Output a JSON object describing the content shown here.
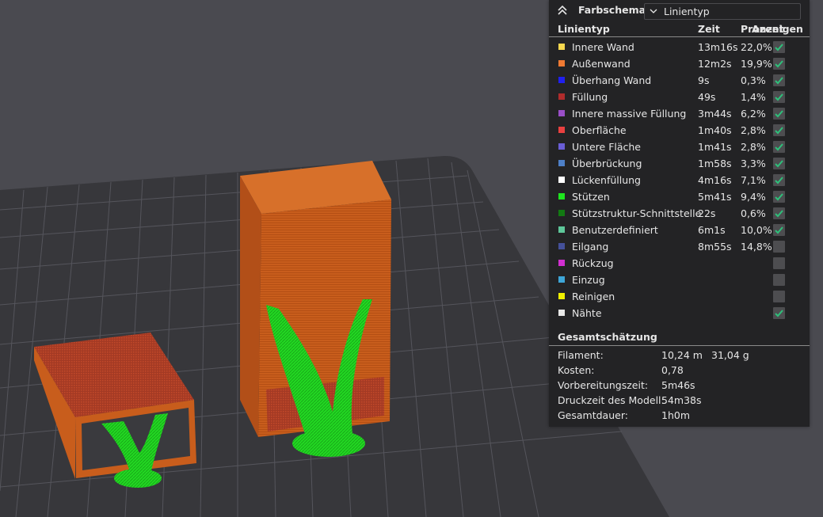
{
  "legend": {
    "title": "Farbschema",
    "scheme_value": "Linientyp",
    "columns": {
      "type": "Linientyp",
      "time": "Zeit",
      "percent": "Prozent",
      "show": "Anzeigen"
    },
    "rows": [
      {
        "label": "Innere Wand",
        "time": "13m16s",
        "percent": "22,0%",
        "color": "#f6d84f",
        "checked": true
      },
      {
        "label": "Außenwand",
        "time": "12m2s",
        "percent": "19,9%",
        "color": "#f07a33",
        "checked": true
      },
      {
        "label": "Überhang Wand",
        "time": "9s",
        "percent": "0,3%",
        "color": "#2020f0",
        "checked": true
      },
      {
        "label": "Füllung",
        "time": "49s",
        "percent": "1,4%",
        "color": "#b02c2c",
        "checked": true
      },
      {
        "label": "Innere massive Füllung",
        "time": "3m44s",
        "percent": "6,2%",
        "color": "#9a4fc8",
        "checked": true
      },
      {
        "label": "Oberfläche",
        "time": "1m40s",
        "percent": "2,8%",
        "color": "#e94040",
        "checked": true
      },
      {
        "label": "Untere Fläche",
        "time": "1m41s",
        "percent": "2,8%",
        "color": "#6a5ed6",
        "checked": true
      },
      {
        "label": "Überbrückung",
        "time": "1m58s",
        "percent": "3,3%",
        "color": "#4e80c8",
        "checked": true
      },
      {
        "label": "Lückenfüllung",
        "time": "4m16s",
        "percent": "7,1%",
        "color": "#ffffff",
        "checked": true
      },
      {
        "label": "Stützen",
        "time": "5m41s",
        "percent": "9,4%",
        "color": "#1ee51e",
        "checked": true
      },
      {
        "label": "Stützstruktur-Schnittstelle",
        "time": "22s",
        "percent": "0,6%",
        "color": "#127a12",
        "checked": true
      },
      {
        "label": "Benutzerdefiniert",
        "time": "6m1s",
        "percent": "10,0%",
        "color": "#5ec79a",
        "checked": true
      },
      {
        "label": "Eilgang",
        "time": "8m55s",
        "percent": "14,8%",
        "color": "#44509a",
        "checked": false
      },
      {
        "label": "Rückzug",
        "time": "",
        "percent": "",
        "color": "#d12fd1",
        "checked": false
      },
      {
        "label": "Einzug",
        "time": "",
        "percent": "",
        "color": "#3ea6d8",
        "checked": false
      },
      {
        "label": "Reinigen",
        "time": "",
        "percent": "",
        "color": "#f0f000",
        "checked": false
      },
      {
        "label": "Nähte",
        "time": "",
        "percent": "",
        "color": "#e8e8e8",
        "checked": true
      }
    ]
  },
  "summary": {
    "title": "Gesamtschätzung",
    "rows": [
      {
        "key": "Filament:",
        "value": "10,24 m",
        "value2": "31,04 g"
      },
      {
        "key": "Kosten:",
        "value": "0,78",
        "value2": ""
      },
      {
        "key": "Vorbereitungszeit:",
        "value": "5m46s",
        "value2": ""
      },
      {
        "key": "Druckzeit des Modell:",
        "value": "54m38s",
        "value2": ""
      },
      {
        "key": "Gesamtdauer:",
        "value": "1h0m",
        "value2": ""
      }
    ]
  },
  "colors": {
    "panel_bg": "#232325",
    "bed": "#38383c",
    "background": "#4a4a50",
    "check": "#2ec07a",
    "wall": "#c45a1a",
    "support": "#22e022"
  }
}
